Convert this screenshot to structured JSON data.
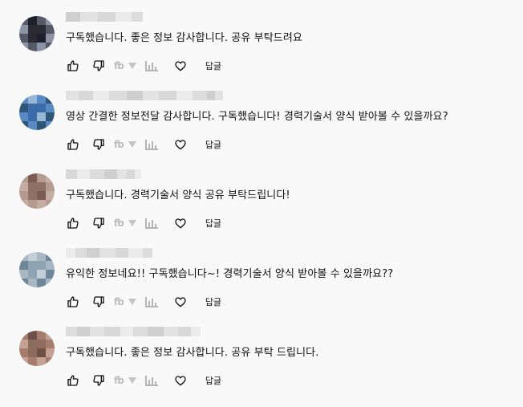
{
  "comments": [
    {
      "text": "구독했습니다. 좋은 정보 감사합니다. 공유 부탁드려요",
      "reply_label": "답글",
      "avatar_colors": [
        "#2a2a33",
        "#565a68",
        "#8b93a6",
        "#1d1f2a"
      ]
    },
    {
      "text": "영상 간결한 정보전달 감사합니다. 구독했습니다! 경력기술서 양식 받아볼 수 있을까요?",
      "reply_label": "답글",
      "avatar_colors": [
        "#3a6da8",
        "#5a8ac4",
        "#2f5577",
        "#98b6d6"
      ]
    },
    {
      "text": "구독했습니다. 경력기술서 양식 공유 부탁드립니다!",
      "reply_label": "답글",
      "avatar_colors": [
        "#8e7066",
        "#b49a8f",
        "#c5ada3",
        "#7a5c52"
      ]
    },
    {
      "text": "유익한 정보네요!! 구독했습니다~! 경력기술서 양식 받아볼 수 있을까요??",
      "reply_label": "답글",
      "avatar_colors": [
        "#8ea4b2",
        "#a7b7c3",
        "#6e8799",
        "#c3ced6"
      ]
    },
    {
      "text": "구독했습니다. 좋은 정보 감사합니다. 공유 부탁 드립니다.",
      "reply_label": "답글",
      "avatar_colors": [
        "#8d6b5d",
        "#a47d6d",
        "#c4a192",
        "#6f5046"
      ]
    }
  ]
}
